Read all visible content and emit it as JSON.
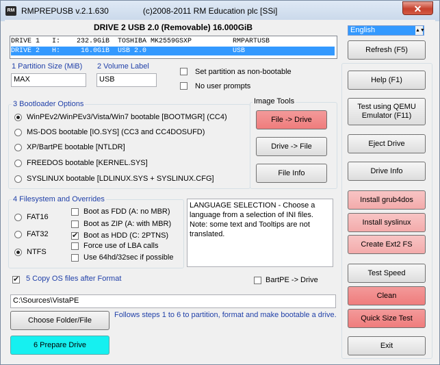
{
  "titlebar": {
    "icon_text": "RM",
    "title": "RMPREPUSB v.2.1.630               (c)2008-2011 RM Education plc [SSi]",
    "close_glyph": "✕"
  },
  "header": {
    "drive_title": "DRIVE 2 USB 2.0  (Removable) 16.000GiB"
  },
  "drives": [
    {
      "text": "DRIVE 1   I:    232.9GiB  TOSHIBA MK2559GSXP          RMPARTUSB"
    },
    {
      "text": "DRIVE 2   H:     16.0GiB  USB 2.0                     USB"
    }
  ],
  "language": {
    "selected": "English",
    "arrow": "▲▼"
  },
  "partition": {
    "label": "1 Partition Size (MiB)",
    "value": "MAX"
  },
  "volume": {
    "label": "2 Volume Label",
    "value": "USB"
  },
  "options": {
    "non_bootable": "Set partition as non-bootable",
    "no_prompts": "No user prompts"
  },
  "bootloader": {
    "title": "3 Bootloader Options",
    "items": [
      "WinPEv2/WinPEv3/Vista/Win7 bootable [BOOTMGR] (CC4)",
      "MS-DOS bootable [IO.SYS]   (CC3 and CC4DOSUFD)",
      "XP/BartPE bootable [NTLDR]",
      "FREEDOS bootable [KERNEL.SYS]",
      "SYSLINUX bootable [LDLINUX.SYS + SYSLINUX.CFG]"
    ]
  },
  "image_tools": {
    "title": "Image Tools",
    "file_to_drive": "File -> Drive",
    "drive_to_file": "Drive -> File",
    "file_info": "File Info"
  },
  "filesystem": {
    "title": "4 Filesystem and Overrides",
    "fs": [
      "FAT16",
      "FAT32",
      "NTFS"
    ],
    "overrides": [
      "Boot as FDD (A: no MBR)",
      "Boot as ZIP (A: with MBR)",
      "Boot as HDD (C: 2PTNS)",
      "Force use of LBA calls",
      "Use 64hd/32sec if possible"
    ]
  },
  "info_text": "LANGUAGE SELECTION - Choose a language from a selection of INI files. Note: some text and Tooltips are not translated.",
  "copy_os": {
    "label": "5 Copy OS files after Format"
  },
  "bartpe": {
    "label": "BartPE -> Drive"
  },
  "path": {
    "value": "C:\\Sources\\VistaPE"
  },
  "choose_folder": "Choose Folder/File",
  "instructions": "Follows steps 1 to 6 to partition, format and make bootable a drive.",
  "prepare": "6 Prepare Drive",
  "right_buttons": {
    "refresh": "Refresh (F5)",
    "help": "Help (F1)",
    "qemu": "Test using QEMU Emulator (F11)",
    "eject": "Eject Drive",
    "drive_info": "Drive Info",
    "grub4dos": "Install grub4dos",
    "syslinux": "Install syslinux",
    "ext2": "Create Ext2 FS",
    "test_speed": "Test Speed",
    "clean": "Clean",
    "quick_size": "Quick Size Test",
    "exit": "Exit"
  },
  "colors": {
    "selection": "#3399ff",
    "red_button": "#ef7c7c",
    "pink_button": "#f5b5b5",
    "cyan_button": "#16f0f0",
    "label_blue": "#1f3fa8"
  }
}
